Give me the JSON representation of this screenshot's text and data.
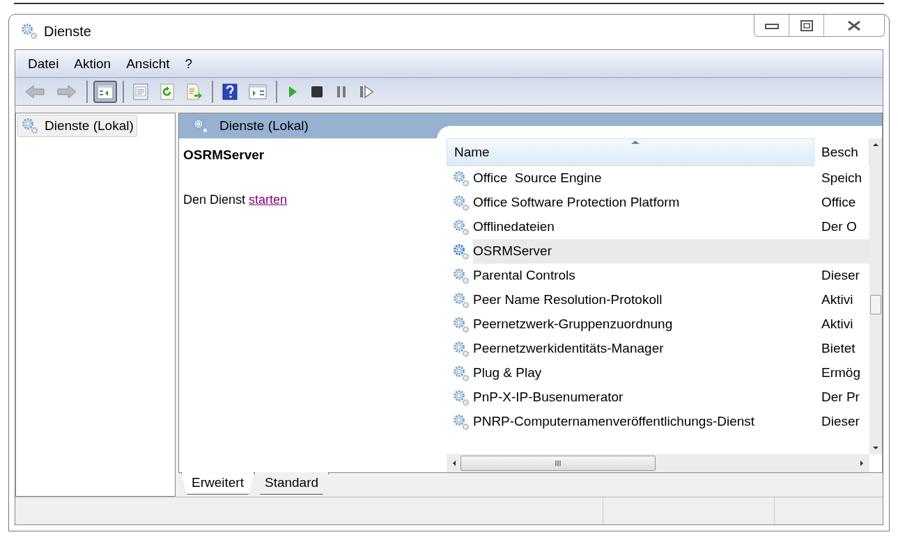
{
  "window": {
    "title": "Dienste"
  },
  "menu": [
    {
      "label": "Datei"
    },
    {
      "label": "Aktion"
    },
    {
      "label": "Ansicht"
    },
    {
      "label": "?"
    }
  ],
  "toolbar": [
    {
      "kind": "back",
      "pressed": false
    },
    {
      "kind": "forward",
      "pressed": false
    },
    {
      "kind": "separator"
    },
    {
      "kind": "tree",
      "pressed": true
    },
    {
      "kind": "separator"
    },
    {
      "kind": "properties",
      "pressed": false
    },
    {
      "kind": "refresh",
      "pressed": false
    },
    {
      "kind": "export",
      "pressed": false
    },
    {
      "kind": "separator"
    },
    {
      "kind": "help",
      "pressed": false
    },
    {
      "kind": "actionpane",
      "pressed": false
    },
    {
      "kind": "separator"
    },
    {
      "kind": "start",
      "pressed": false
    },
    {
      "kind": "stop",
      "pressed": false
    },
    {
      "kind": "pause",
      "pressed": false
    },
    {
      "kind": "resume",
      "pressed": false
    }
  ],
  "tree": [
    {
      "label": "Dienste (Lokal)",
      "selected": true
    }
  ],
  "panel": {
    "title": "Dienste (Lokal)"
  },
  "details": {
    "service": "OSRMServer",
    "action_prefix": "Den Dienst",
    "action_link": "starten"
  },
  "table": {
    "columns": [
      {
        "label": "Name",
        "sorted": true
      },
      {
        "label": "Besch",
        "sorted": false
      }
    ],
    "rows": [
      {
        "name": "Office  Source Engine",
        "description": "Speich",
        "selected": false
      },
      {
        "name": "Office Software Protection Platform",
        "description": "Office",
        "selected": false
      },
      {
        "name": "Offlinedateien",
        "description": "Der O",
        "selected": false
      },
      {
        "name": "OSRMServer",
        "selected": true
      },
      {
        "name": "Parental Controls",
        "description": "Dieser",
        "selected": false
      },
      {
        "name": "Peer Name Resolution-Protokoll",
        "description": "Aktivi",
        "selected": false
      },
      {
        "name": "Peernetzwerk-Gruppenzuordnung",
        "description": "Aktivi",
        "selected": false
      },
      {
        "name": "Peernetzwerkidentitäts-Manager",
        "description": "Bietet",
        "selected": false
      },
      {
        "name": "Plug & Play",
        "description": "Ermög",
        "selected": false
      },
      {
        "name": "PnP-X-IP-Busenumerator",
        "description": "Der Pr",
        "selected": false
      },
      {
        "name": "PNRP-Computernamenveröffentlichungs-Dienst",
        "description": "Dieser",
        "selected": false
      }
    ]
  },
  "tabs": [
    {
      "label": "Erweitert",
      "selected": true
    },
    {
      "label": "Standard",
      "selected": false
    }
  ]
}
